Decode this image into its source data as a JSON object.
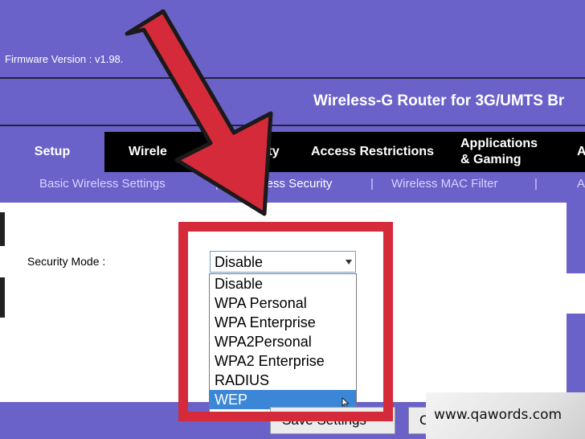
{
  "header": {
    "firmware": "Firmware Version  : v1.98.",
    "product_title": "Wireless-G Router for 3G/UMTS Br"
  },
  "main_nav": {
    "setup": "Setup",
    "wireless": "Wirele",
    "security": "urity",
    "access_restrictions": "Access Restrictions",
    "applications_line1": "Applications",
    "applications_line2": "& Gaming",
    "more": "A"
  },
  "sub_nav": {
    "basic_wireless": "Basic Wireless Settings",
    "sep1": "|",
    "wireless_security": "eless Security",
    "sep2": "|",
    "mac_filter": "Wireless MAC Filter",
    "sep3": "|",
    "more": "A"
  },
  "form": {
    "security_mode_label": "Security Mode  :",
    "security_mode_value": "Disable",
    "options": [
      "Disable",
      "WPA Personal",
      "WPA Enterprise",
      "WPA2Personal",
      "WPA2 Enterprise",
      "RADIUS",
      "WEP"
    ],
    "highlighted_option": "WEP"
  },
  "buttons": {
    "save": "Save Settings",
    "cancel": "C"
  },
  "watermark": "www.qawords.com",
  "colors": {
    "brand_purple": "#6a62c9",
    "nav_black": "#000000",
    "annotation_red": "#d42a3a",
    "selection_blue": "#3b86d6"
  }
}
